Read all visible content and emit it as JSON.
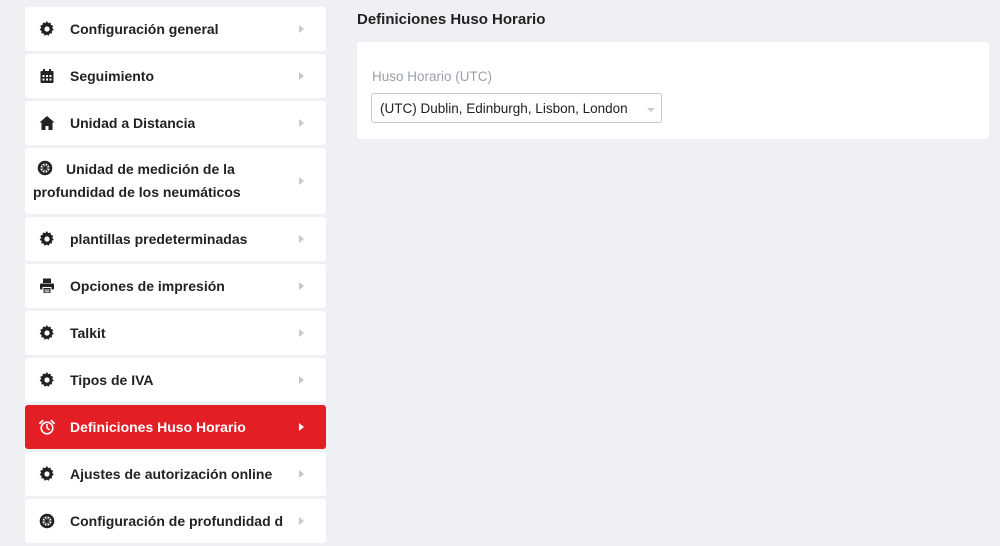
{
  "sidebar": {
    "items": [
      {
        "label": "Configuración general",
        "icon": "gear-icon"
      },
      {
        "label": "Seguimiento",
        "icon": "calendar-icon"
      },
      {
        "label": "Unidad a Distancia",
        "icon": "home-icon"
      },
      {
        "label": "Unidad de medición de la profundidad de los neumáticos",
        "icon": "tire-icon"
      },
      {
        "label": "plantillas predeterminadas",
        "icon": "gear-icon"
      },
      {
        "label": "Opciones de impresión",
        "icon": "printer-icon"
      },
      {
        "label": "Talkit",
        "icon": "gear-icon"
      },
      {
        "label": "Tipos de IVA",
        "icon": "gear-icon"
      },
      {
        "label": "Definiciones Huso Horario",
        "icon": "alarm-clock-icon",
        "active": true
      },
      {
        "label": "Ajustes de autorización online",
        "icon": "gear-icon"
      },
      {
        "label": "Configuración de profundidad d",
        "icon": "tire-icon"
      }
    ]
  },
  "main": {
    "title": "Definiciones Huso Horario",
    "field": {
      "label": "Huso Horario (UTC)",
      "value": "(UTC) Dublin, Edinburgh, Lisbon, London"
    }
  },
  "colors": {
    "accent": "#e31e24",
    "background": "#eef0f3",
    "panel": "#ffffff"
  }
}
